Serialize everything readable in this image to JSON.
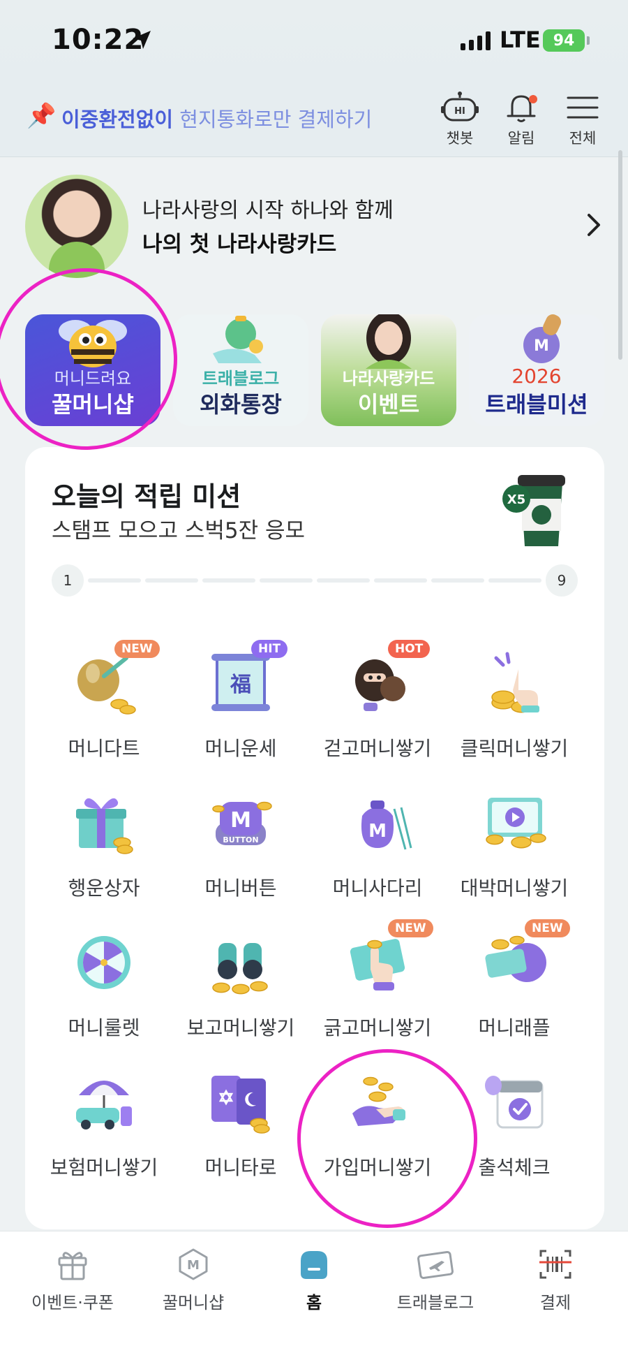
{
  "status_bar": {
    "time": "10:22",
    "network": "LTE",
    "battery": "94"
  },
  "header": {
    "promo_bold": "이중환전없이",
    "promo_rest": " 현지통화로만 결제하기",
    "buttons": [
      {
        "label": "챗봇",
        "icon": "chatbot-icon"
      },
      {
        "label": "알림",
        "icon": "bell-icon"
      },
      {
        "label": "전체",
        "icon": "menu-icon"
      }
    ],
    "chatbot_glyph": "HI"
  },
  "banner": {
    "line1": "나라사랑의 시작 하나와 함께",
    "line2": "나의 첫 나라사랑카드"
  },
  "shortcuts": [
    {
      "line1": "머니드려요",
      "line2": "꿀머니샵"
    },
    {
      "line1": "트래블로그",
      "line2": "외화통장"
    },
    {
      "line1": "나라사랑카드",
      "line2": "이벤트"
    },
    {
      "line1": "2026",
      "line2": "트래블미션"
    }
  ],
  "mission": {
    "title": "오늘의 적립 미션",
    "subtitle": "스탬프 모으고 스벅5잔 응모",
    "cup_badge": "X5",
    "progress_start": "1",
    "progress_end": "9",
    "progress_segments": 8
  },
  "missions": [
    {
      "name": "머니다트",
      "badge": "NEW",
      "icon": "dart-icon"
    },
    {
      "name": "머니운세",
      "badge": "HIT",
      "icon": "fortune-scroll-icon",
      "glyph": "福"
    },
    {
      "name": "걷고머니쌓기",
      "badge": "HOT",
      "icon": "walking-character-icon"
    },
    {
      "name": "클릭머니쌓기",
      "badge": "",
      "icon": "click-hand-icon"
    },
    {
      "name": "행운상자",
      "badge": "",
      "icon": "gift-box-icon"
    },
    {
      "name": "머니버튼",
      "badge": "",
      "icon": "money-button-icon",
      "glyph": "M",
      "sub": "BUTTON"
    },
    {
      "name": "머니사다리",
      "badge": "",
      "icon": "money-bag-ladder-icon",
      "glyph": "M"
    },
    {
      "name": "대박머니쌓기",
      "badge": "",
      "icon": "video-play-icon"
    },
    {
      "name": "머니룰렛",
      "badge": "",
      "icon": "roulette-icon"
    },
    {
      "name": "보고머니쌓기",
      "badge": "",
      "icon": "binoculars-icon"
    },
    {
      "name": "긁고머니쌓기",
      "badge": "NEW",
      "icon": "scratch-ticket-icon"
    },
    {
      "name": "머니래플",
      "badge": "NEW",
      "icon": "raffle-icon"
    },
    {
      "name": "보험머니쌓기",
      "badge": "",
      "icon": "insurance-car-umbrella-icon"
    },
    {
      "name": "머니타로",
      "badge": "",
      "icon": "tarot-cards-icon"
    },
    {
      "name": "가입머니쌓기",
      "badge": "",
      "icon": "signup-hand-coins-icon"
    },
    {
      "name": "출석체크",
      "badge": "",
      "icon": "attendance-calendar-icon"
    }
  ],
  "tabbar": [
    {
      "label": "이벤트·쿠폰",
      "icon": "gift-icon",
      "active": false
    },
    {
      "label": "꿀머니샵",
      "icon": "m-hexagon-icon",
      "active": false,
      "glyph": "M"
    },
    {
      "label": "홈",
      "icon": "home-icon",
      "active": true
    },
    {
      "label": "트래블로그",
      "icon": "travel-ticket-icon",
      "active": false
    },
    {
      "label": "결제",
      "icon": "barcode-scan-icon",
      "active": false
    }
  ],
  "colors": {
    "accent_blue": "#4a5fd8",
    "highlight_circle": "#ec22c4",
    "badge_new": "#f08a5d",
    "badge_hit": "#8e6cf0",
    "badge_hot": "#f2644f",
    "home_tab": "#4aa3c7"
  }
}
